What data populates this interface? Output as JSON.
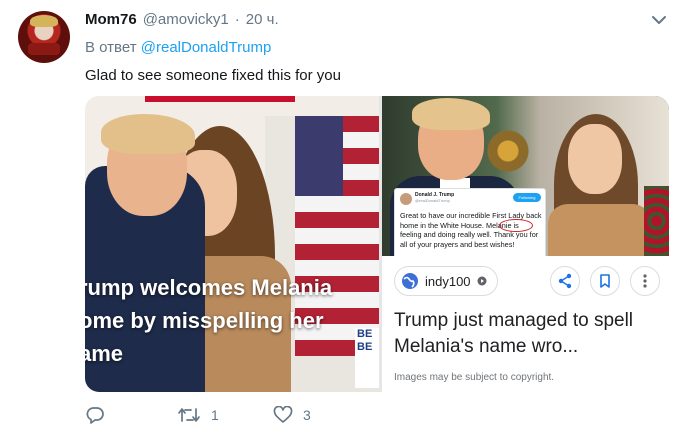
{
  "tweet": {
    "display_name": "Mom76",
    "handle": "@amovicky1",
    "separator": "·",
    "time": "20 ч.",
    "reply_prefix": "В ответ",
    "reply_handle": "@realDonaldTrump",
    "text": "Glad to see someone fixed this for you"
  },
  "media_left": {
    "caption_lines": [
      "rump welcomes Melania",
      "ome by misspelling her",
      "ame"
    ],
    "sign_lines": [
      "BE",
      "BE"
    ]
  },
  "media_right": {
    "embed": {
      "name": "Donald J. Trump",
      "handle": "@realDonaldTrump",
      "follow": "Following",
      "text": "Great to have our incredible First Lady back home in the White House. Melanie is feeling and doing really well. Thank you for all of your prayers and best wishes!"
    },
    "source": "indy100",
    "title": "Trump just managed to spell Melania's name wro...",
    "note": "Images may be subject to copyright."
  },
  "actions": {
    "reply_count": "",
    "retweet_count": "1",
    "like_count": "3"
  },
  "icons": [
    "chevron-down-icon",
    "globe-icon",
    "info-icon",
    "share-icon",
    "bookmark-icon",
    "more-vertical-icon",
    "reply-icon",
    "retweet-icon",
    "like-icon"
  ],
  "colors": {
    "link": "#1da1f2",
    "muted": "#657786",
    "text": "#14171a"
  }
}
